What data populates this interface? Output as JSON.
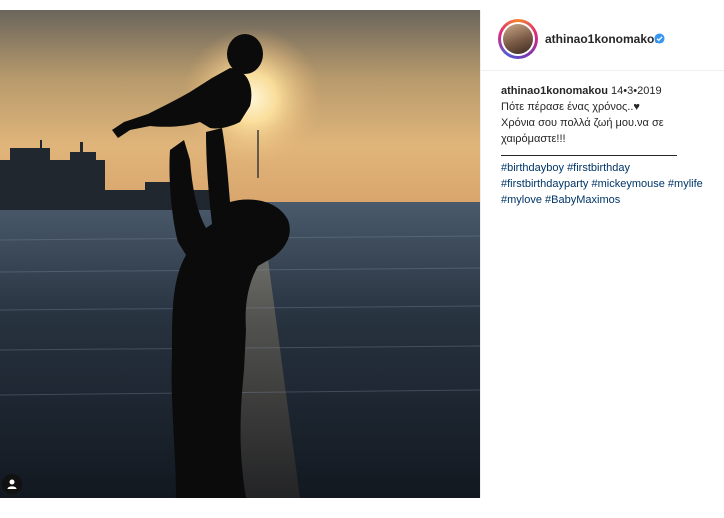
{
  "post": {
    "username": "athinao1konomakou",
    "verified_icon": "verified-badge-icon",
    "caption": {
      "username": "athinao1konomakou",
      "date": "14•3•2019",
      "line1": "Πότε πέρασε ένας χρόνος..♥",
      "line2": "Χρόνια σου πολλά ζωή μου.να σε",
      "line3": "χαιρόμαστε!!!",
      "hashtags": [
        "#birthdayboy",
        "#firstbirthday",
        "#firstbirthdayparty",
        "#mickeymouse",
        "#mylife",
        "#mylove",
        "#BabyMaximos"
      ]
    }
  },
  "colors": {
    "link": "#003569",
    "text": "#262626",
    "border": "#efefef"
  }
}
